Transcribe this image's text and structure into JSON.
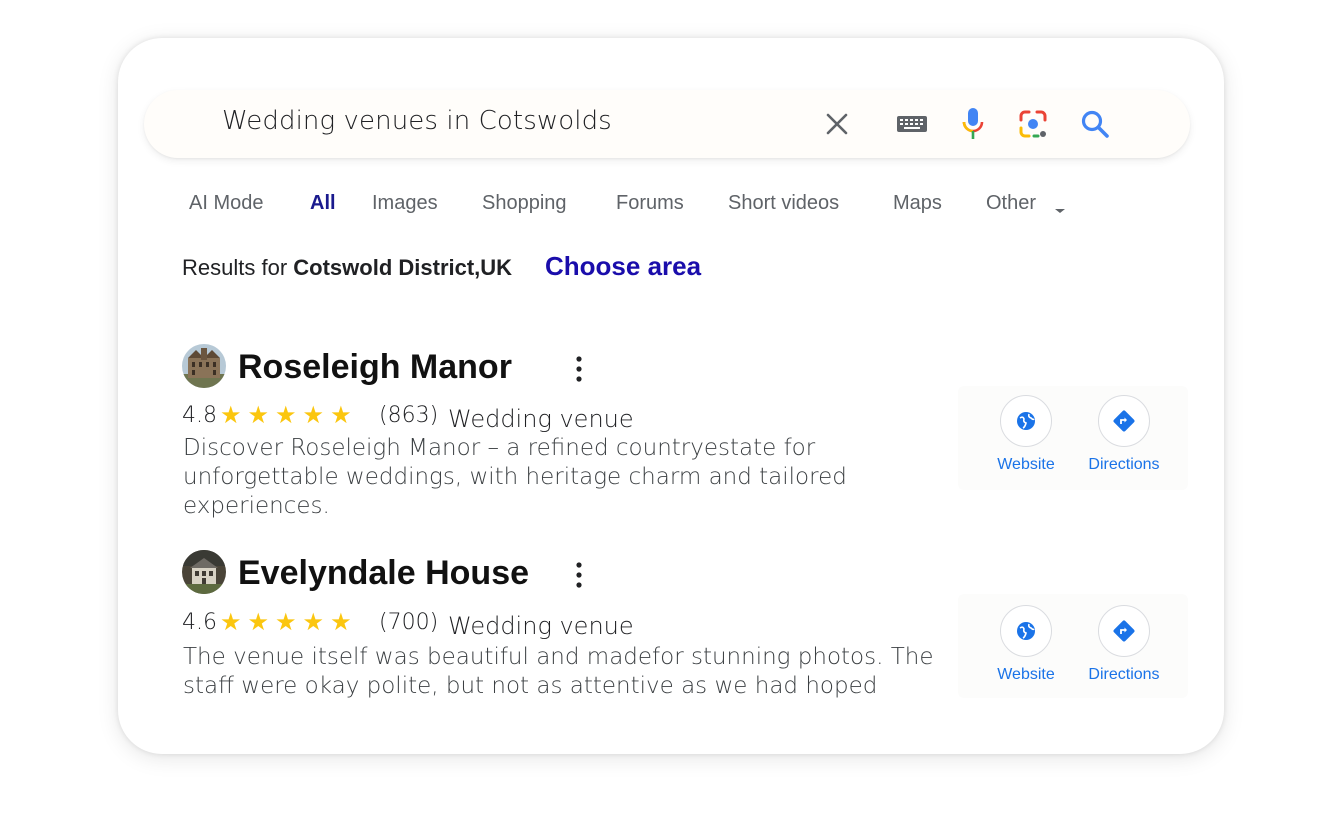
{
  "search": {
    "query": "Wedding venues in Cotswolds",
    "icons": [
      "close-icon",
      "keyboard-icon",
      "microphone-icon",
      "lens-icon",
      "search-icon"
    ]
  },
  "tabs": [
    {
      "label": "AI Mode",
      "active": false
    },
    {
      "label": "All",
      "active": true
    },
    {
      "label": "Images",
      "active": false
    },
    {
      "label": "Shopping",
      "active": false
    },
    {
      "label": "Forums",
      "active": false
    },
    {
      "label": "Short videos",
      "active": false
    },
    {
      "label": "Maps",
      "active": false
    },
    {
      "label": "Other",
      "active": false
    }
  ],
  "location": {
    "prefix": "Results for",
    "place": "Cotswold District,UK",
    "link": "Choose area"
  },
  "results": [
    {
      "name": "Roseleigh Manor",
      "rating": "4.8",
      "stars": 5,
      "reviews": "(863)",
      "type": "Wedding venue",
      "description": "Discover Roseleigh Manor – a refined countryestate for unforgettable weddings, with heritage charm and tailored experiences.",
      "website_label": "Website",
      "directions_label": "Directions"
    },
    {
      "name": "Evelyndale House",
      "rating": "4.6",
      "stars": 5,
      "reviews": "(700)",
      "type": "Wedding venue",
      "description": "The venue itself was beautiful and madefor stunning photos. The staff were okay polite, but not as attentive as we had hoped",
      "website_label": "Website",
      "directions_label": "Directions"
    }
  ],
  "colors": {
    "active_tab": "#1a1a8e",
    "link": "#1a0dab",
    "star": "#fbc60f",
    "action_blue": "#1a73e8"
  }
}
